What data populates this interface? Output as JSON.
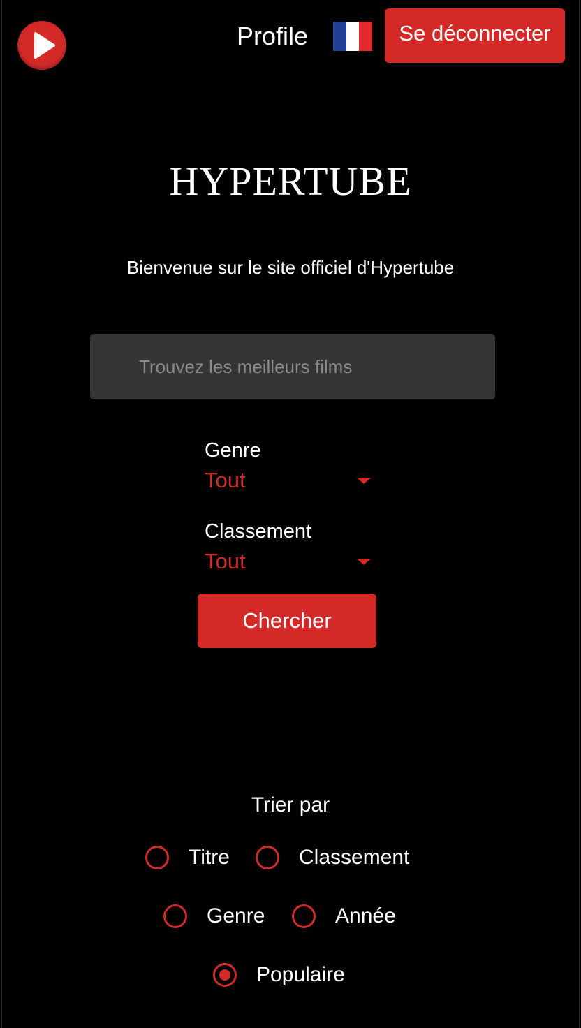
{
  "header": {
    "profile_label": "Profile",
    "logout_label": "Se déconnecter",
    "language_flag": "french-flag",
    "flag_colors": [
      "#1f3f94",
      "#ffffff",
      "#e32b2e"
    ],
    "logo_icon": "play-icon"
  },
  "main": {
    "title": "HYPERTUBE",
    "welcome": "Bienvenue sur le site officiel d'Hypertube",
    "search": {
      "placeholder": "Trouvez les meilleurs films",
      "value": ""
    },
    "filters": {
      "genre": {
        "label": "Genre",
        "selected": "Tout"
      },
      "rating": {
        "label": "Classement",
        "selected": "Tout"
      }
    },
    "search_button": "Chercher"
  },
  "sort": {
    "title": "Trier par",
    "options": [
      {
        "label": "Titre",
        "checked": false
      },
      {
        "label": "Classement",
        "checked": false
      },
      {
        "label": "Genre",
        "checked": false
      },
      {
        "label": "Année",
        "checked": false
      },
      {
        "label": "Populaire",
        "checked": true
      }
    ]
  },
  "colors": {
    "accent": "#d32a28",
    "background": "#000000",
    "input_bg": "#353535"
  }
}
